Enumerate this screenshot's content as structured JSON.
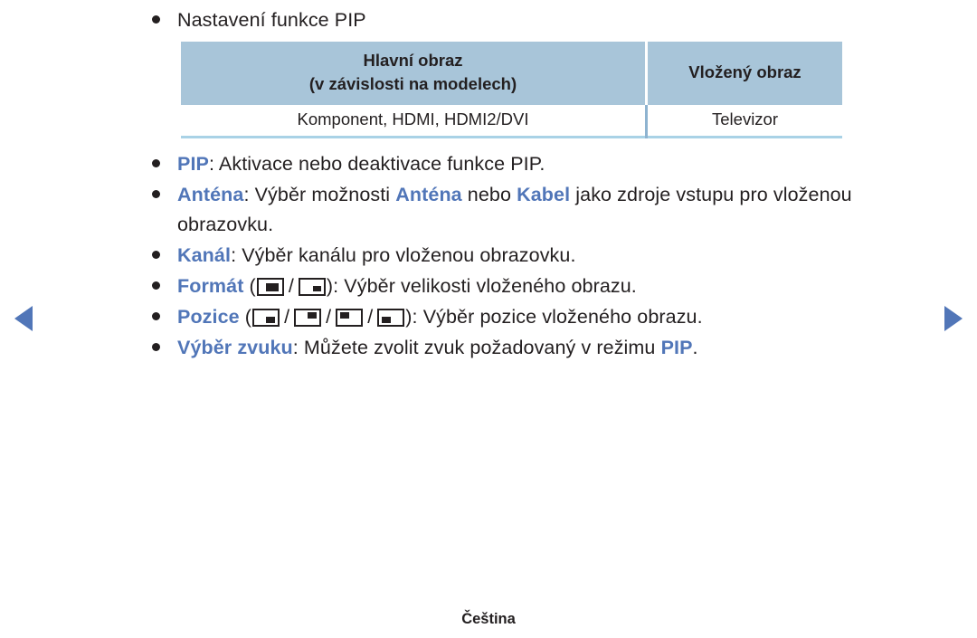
{
  "nav": {
    "prev_label": "prev-page-arrow",
    "next_label": "next-page-arrow",
    "accent_color": "#5176b8"
  },
  "heading": {
    "text": "Nastavení funkce PIP"
  },
  "table": {
    "headers": {
      "main_line1": "Hlavní obraz",
      "main_line2": "(v závislosti na modelech)",
      "sub": "Vložený obraz"
    },
    "rows": [
      {
        "main": "Komponent, HDMI, HDMI2/DVI",
        "sub": "Televizor"
      }
    ],
    "header_bg": "#a8c5d9",
    "divider_color": "#8eb3d0",
    "bottom_rule_color": "#a9d2e6"
  },
  "items": [
    {
      "term": "PIP",
      "after_term": ": Aktivace nebo deaktivace funkce PIP."
    },
    {
      "term": "Anténa",
      "after_term": ": Výběr možnosti ",
      "inline_b1": "Anténa",
      "mid": " nebo ",
      "inline_b2": "Kabel",
      "tail": " jako zdroje vstupu pro vloženou obrazovku."
    },
    {
      "term": "Kanál",
      "after_term": ": Výběr kanálu pro vloženou obrazovku."
    },
    {
      "term": "Formát",
      "open_paren": " (",
      "slash": "/",
      "close_paren": "): Výběr velikosti vloženého obrazu.",
      "icons": [
        "pip-format-large-icon",
        "pip-format-small-icon"
      ]
    },
    {
      "term": "Pozice",
      "open_paren": " (",
      "slash": "/",
      "close_paren": "): Výběr pozice vloženého obrazu.",
      "icons": [
        "pip-position-bottom-right-icon",
        "pip-position-top-right-icon",
        "pip-position-top-left-icon",
        "pip-position-bottom-left-icon"
      ]
    },
    {
      "term": "Výběr zvuku",
      "after_term": ": Můžete zvolit zvuk požadovaný v režimu ",
      "inline_b1": "PIP",
      "tail": "."
    }
  ],
  "footer": {
    "language": "Čeština"
  }
}
